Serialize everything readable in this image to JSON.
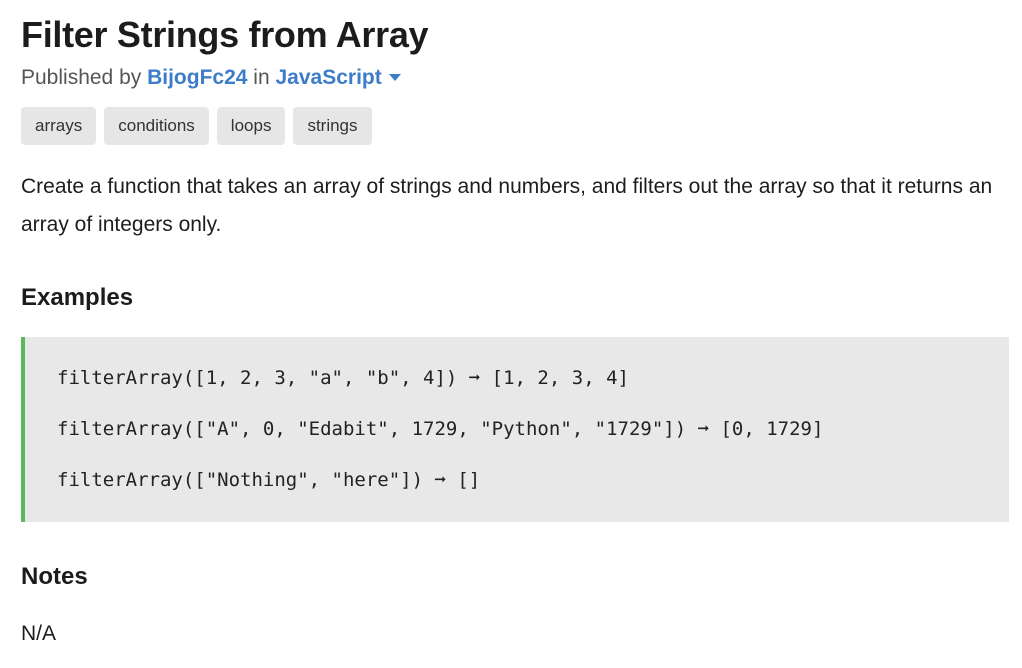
{
  "challenge": {
    "title": "Filter Strings from Array",
    "published_by_prefix": "Published by",
    "author": "BijogFc24",
    "in_word": "in",
    "language": "JavaScript",
    "tags": [
      "arrays",
      "conditions",
      "loops",
      "strings"
    ],
    "description": "Create a function that takes an array of strings and numbers, and filters out the array so that it returns an array of integers only."
  },
  "examples": {
    "heading": "Examples",
    "accent_color": "#5cb85c",
    "lines": [
      "filterArray([1, 2, 3, \"a\", \"b\", 4]) ➞ [1, 2, 3, 4]",
      "filterArray([\"A\", 0, \"Edabit\", 1729, \"Python\", \"1729\"]) ➞ [0, 1729]",
      "filterArray([\"Nothing\", \"here\"]) ➞ []"
    ]
  },
  "notes": {
    "heading": "Notes",
    "text": "N/A"
  },
  "colors": {
    "link": "#3d7cc9",
    "tag_bg": "#e6e6e6",
    "code_bg": "#e8e8e8"
  }
}
